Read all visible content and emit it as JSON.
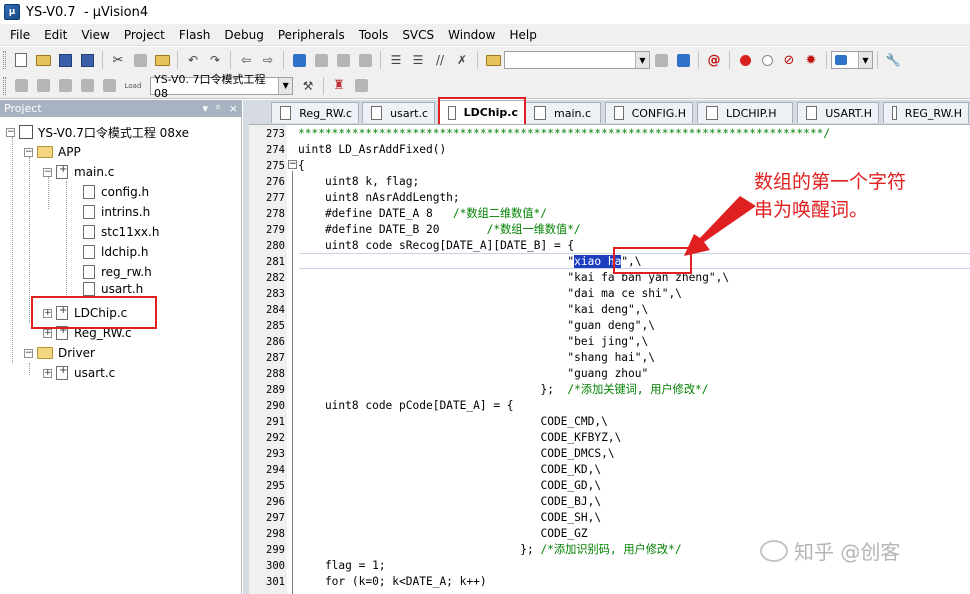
{
  "window": {
    "title": "YS-V0.7  - µVision4"
  },
  "menu": {
    "items": [
      {
        "label": "File",
        "key": "F"
      },
      {
        "label": "Edit",
        "key": "E"
      },
      {
        "label": "View",
        "key": "V"
      },
      {
        "label": "Project",
        "key": "P"
      },
      {
        "label": "Flash",
        "key": "a"
      },
      {
        "label": "Debug",
        "key": "D"
      },
      {
        "label": "Peripherals",
        "key": "r"
      },
      {
        "label": "Tools",
        "key": "T"
      },
      {
        "label": "SVCS",
        "key": "S"
      },
      {
        "label": "Window",
        "key": "W"
      },
      {
        "label": "Help",
        "key": "H"
      }
    ]
  },
  "toolbar": {
    "target_combo": "YS-V0. 7口令模式工程  08",
    "load_label": "Load"
  },
  "project": {
    "header": "Project",
    "controls": [
      "▾",
      "ᵖ",
      "×"
    ],
    "root": "YS-V0.7口令模式工程 08xe",
    "groups": {
      "app": "APP",
      "driver": "Driver"
    },
    "files": {
      "main_c": "main.c",
      "config_h": "config.h",
      "intrins_h": "intrins.h",
      "stc11xx_h": "stc11xx.h",
      "ldchip_h": "ldchip.h",
      "reg_rw_h": "reg_rw.h",
      "usart_h": "usart.h",
      "ldchip_c": "LDChip.c",
      "reg_rw_c": "Reg_RW.c",
      "usart_c": "usart.c"
    }
  },
  "tabs": [
    {
      "label": "Reg_RW.c",
      "active": false
    },
    {
      "label": "usart.c",
      "active": false
    },
    {
      "label": "LDChip.c",
      "active": true
    },
    {
      "label": "main.c",
      "active": false
    },
    {
      "label": "CONFIG.H",
      "active": false
    },
    {
      "label": "LDCHIP.H",
      "active": false
    },
    {
      "label": "USART.H",
      "active": false
    },
    {
      "label": "REG_RW.H",
      "active": false
    }
  ],
  "editor": {
    "lines": [
      {
        "n": "273",
        "text": "******************************************************************************/"
      },
      {
        "n": "274",
        "text": "uint8 LD_AsrAddFixed()"
      },
      {
        "n": "275",
        "text": "{"
      },
      {
        "n": "276",
        "text": "    uint8 k, flag;"
      },
      {
        "n": "277",
        "text": "    uint8 nAsrAddLength;"
      },
      {
        "n": "278",
        "pre": "    #define DATE_A 8   ",
        "comment": "/*数组二维数值*/"
      },
      {
        "n": "279",
        "pre": "    #define DATE_B 20       ",
        "comment": "/*数组一维数值*/"
      },
      {
        "n": "280",
        "text": "    uint8 code sRecog[DATE_A][DATE_B] = {"
      },
      {
        "n": "281",
        "pre": "                                        \"",
        "selected": "xiao ha",
        "post": "\",\\"
      },
      {
        "n": "282",
        "text": "                                        \"kai fa ban yan zheng\",\\"
      },
      {
        "n": "283",
        "text": "                                        \"dai ma ce shi\",\\"
      },
      {
        "n": "284",
        "text": "                                        \"kai deng\",\\"
      },
      {
        "n": "285",
        "text": "                                        \"guan deng\",\\"
      },
      {
        "n": "286",
        "text": "                                        \"bei jing\",\\"
      },
      {
        "n": "287",
        "text": "                                        \"shang hai\",\\"
      },
      {
        "n": "288",
        "text": "                                        \"guang zhou\""
      },
      {
        "n": "289",
        "pre": "                                    };  ",
        "comment": "/*添加关键词, 用户修改*/"
      },
      {
        "n": "290",
        "text": "    uint8 code pCode[DATE_A] = {"
      },
      {
        "n": "291",
        "text": "                                    CODE_CMD,\\"
      },
      {
        "n": "292",
        "text": "                                    CODE_KFBYZ,\\"
      },
      {
        "n": "293",
        "text": "                                    CODE_DMCS,\\"
      },
      {
        "n": "294",
        "text": "                                    CODE_KD,\\"
      },
      {
        "n": "295",
        "text": "                                    CODE_GD,\\"
      },
      {
        "n": "296",
        "text": "                                    CODE_BJ,\\"
      },
      {
        "n": "297",
        "text": "                                    CODE_SH,\\"
      },
      {
        "n": "298",
        "text": "                                    CODE_GZ"
      },
      {
        "n": "299",
        "pre": "                                 }; ",
        "comment": "/*添加识别码, 用户修改*/"
      },
      {
        "n": "300",
        "text": "    flag = 1;"
      },
      {
        "n": "301",
        "text": "    for (k=0; k<DATE_A; k++)"
      }
    ]
  },
  "annotation": {
    "line1": "数组的第一个字符",
    "line2": "串为唤醒词。",
    "color": "#e02020"
  },
  "watermark": {
    "text": "知乎 @创客"
  }
}
